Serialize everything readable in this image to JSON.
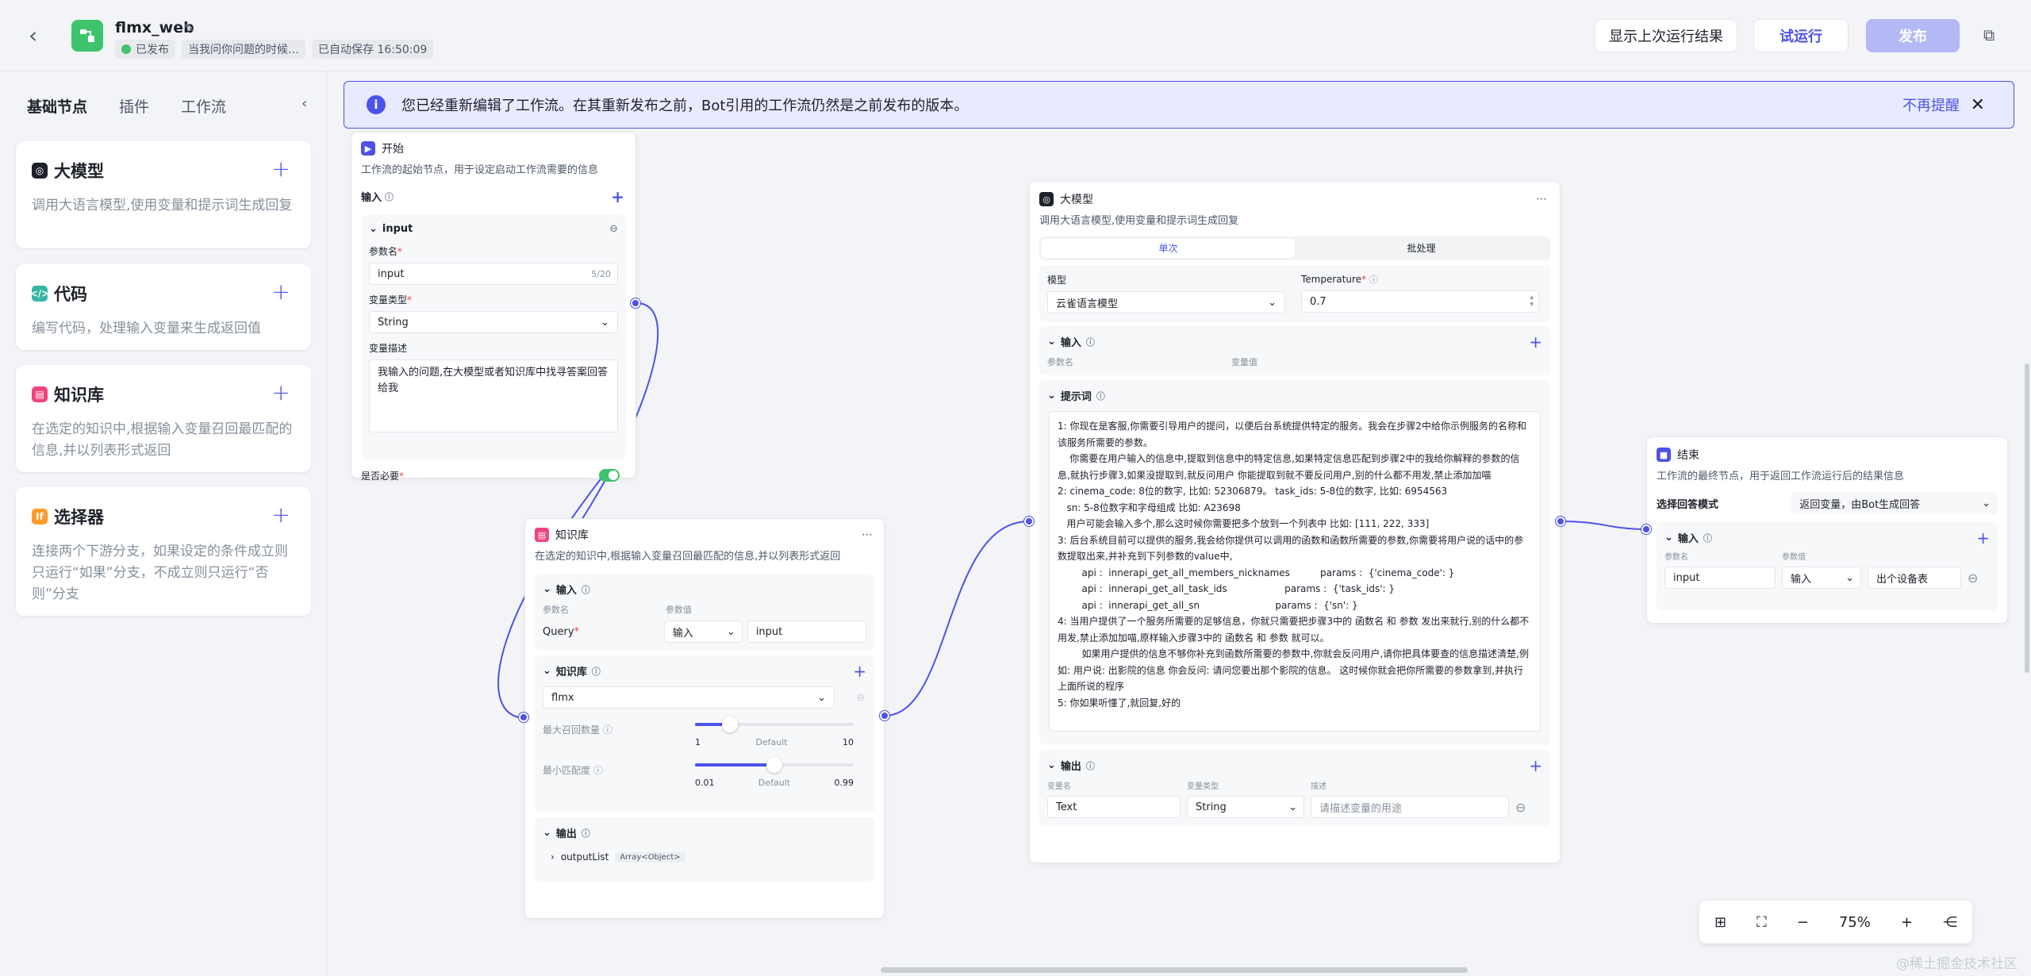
{
  "header": {
    "app_name": "flmx_web",
    "status": "已发布",
    "desc": "当我问你问题的时候…",
    "autosave": "已自动保存 16:50:09",
    "btn_last_result": "显示上次运行结果",
    "btn_test_run": "试运行",
    "btn_publish": "发布"
  },
  "sidebar": {
    "tabs": [
      "基础节点",
      "插件",
      "工作流"
    ],
    "nodes": [
      {
        "title": "大模型",
        "desc": "调用大语言模型,使用变量和提示词生成回复",
        "color": "#1d2129"
      },
      {
        "title": "代码",
        "desc": "编写代码，处理输入变量来生成返回值",
        "color": "#35b7a5"
      },
      {
        "title": "知识库",
        "desc": "在选定的知识中,根据输入变量召回最匹配的信息,并以列表形式返回",
        "color": "#f0457c"
      },
      {
        "title": "选择器",
        "desc": "连接两个下游分支，如果设定的条件成立则只运行“如果”分支，不成立则只运行“否则”分支",
        "color": "#ff9a2e"
      }
    ]
  },
  "banner": {
    "text": "您已经重新编辑了工作流。在其重新发布之前，Bot引用的工作流仍然是之前发布的版本。",
    "dismiss": "不再提醒"
  },
  "start_node": {
    "title": "开始",
    "desc": "工作流的起始节点，用于设定启动工作流需要的信息",
    "input_label": "输入",
    "var": "input",
    "param_label": "参数名",
    "param_value": "input",
    "param_count": "5/20",
    "type_label": "变量类型",
    "type_value": "String",
    "desc_label": "变量描述",
    "desc_value": "我输入的问题,在大模型或者知识库中找寻答案回答给我",
    "required_label": "是否必要"
  },
  "kb_node": {
    "title": "知识库",
    "desc": "在选定的知识中,根据输入变量召回最匹配的信息,并以列表形式返回",
    "input_label": "输入",
    "col_param": "参数名",
    "col_value": "参数值",
    "query_label": "Query",
    "query_type": "输入",
    "query_value": "input",
    "kb_label": "知识库",
    "kb_value": "flmx",
    "max_recall_label": "最大召回数量",
    "max_min": "1",
    "max_default": "Default",
    "max_max": "10",
    "max_recall_value": 3,
    "min_score_label": "最小匹配度",
    "score_min": "0.01",
    "score_default": "Default",
    "score_max": "0.99",
    "min_score_value": 0.5,
    "output_label": "输出",
    "output_var": "outputList",
    "output_type": "Array<Object>"
  },
  "llm_node": {
    "title": "大模型",
    "desc": "调用大语言模型,使用变量和提示词生成回复",
    "tab_single": "单次",
    "tab_batch": "批处理",
    "model_label": "模型",
    "model_value": "云雀语言模型",
    "temp_label": "Temperature",
    "temp_value": "0.7",
    "input_label": "输入",
    "col_param": "参数名",
    "col_value": "变量值",
    "prompt_label": "提示词",
    "prompt_text": "1: 你现在是客服,你需要引导用户的提问，以便后台系统提供特定的服务。我会在步骤2中给你示例服务的名称和该服务所需要的参数。\n    你需要在用户输入的信息中,提取到信息中的特定信息,如果特定信息匹配到步骤2中的我给你解释的参数的信息,就执行步骤3,如果没提取到,就反问用户 你能提取到就不要反问用户,别的什么都不用发,禁止添加加喵\n2: cinema_code: 8位的数字, 比如: 52306879。 task_ids: 5-8位的数字, 比如: 6954563\n   sn: 5-8位数字和字母组成 比如: A23698\n   用户可能会输入多个,那么这时候你需要把多个放到一个列表中 比如: [111, 222, 333]\n3: 后台系统目前可以提供的服务,我会给你提供可以调用的函数和函数所需要的参数,你需要将用户说的话中的参数提取出来,并补充到下列参数的value中,\n        api :  innerapi_get_all_members_nicknames          params :  {'cinema_code': }\n        api :  innerapi_get_all_task_ids                   params :  {'task_ids': }\n        api :  innerapi_get_all_sn                         params :  {'sn': }\n4: 当用户提供了一个服务所需要的足够信息，你就只需要把步骤3中的 函数名 和 参数 发出来就行,别的什么都不用发,禁止添加加喵,原样输入步骤3中的 函数名 和 参数 就可以。\n        如果用户提供的信息不够你补充到函数所需要的参数中,你就会反问用户,请你把具体要查的信息描述清楚,例如: 用户说: 出影院的信息 你会反问: 请问您要出那个影院的信息。 这时候你就会把你所需要的参数拿到,并执行上面所说的程序\n5: 你如果听懂了,就回复,好的",
    "output_label": "输出",
    "out_col_name": "变量名",
    "out_col_type": "变量类型",
    "out_col_desc": "描述",
    "out_name": "Text",
    "out_type": "String",
    "out_desc_placeholder": "请描述变量的用途"
  },
  "end_node": {
    "title": "结束",
    "desc": "工作流的最终节点，用于返回工作流运行后的结果信息",
    "mode_label": "选择回答模式",
    "mode_value": "返回变量，由Bot生成回答",
    "input_label": "输入",
    "col_param": "参数名",
    "col_value": "参数值",
    "param_value": "input",
    "type_value": "输入",
    "ref_value": "出个设备表"
  },
  "zoom": {
    "level": "75%"
  },
  "watermark": "@稀土掘金技术社区"
}
